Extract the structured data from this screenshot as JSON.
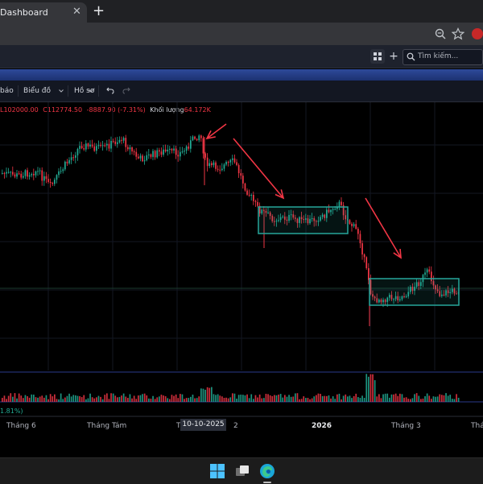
{
  "browser": {
    "tab_title": "Dashboard",
    "tab_close": "✕",
    "new_tab": "+"
  },
  "tv_header": {
    "search_placeholder": "Tìm kiếm..."
  },
  "toolbar": {
    "items": [
      "báo",
      "Biểu đồ",
      "Hồ sơ"
    ],
    "undo_icon": "undo-icon",
    "redo_icon": "redo-icon"
  },
  "legend": {
    "low": "L102000.00",
    "close": "C112774.50",
    "change": "-8887.90 (-7.31%)",
    "volume_label": "Khối lượng",
    "volume_value": "64.172K"
  },
  "volume_pct": "1.81%)",
  "x_axis": {
    "labels": [
      "Tháng 6",
      "Tháng Tám",
      "T",
      "2",
      "2026",
      "Tháng 3",
      "Thá"
    ],
    "highlighted": "10-10-2025"
  },
  "colors": {
    "up": "#22ab94",
    "down": "#f23645",
    "arrow": "#f23645",
    "range_box": "#26a69a"
  },
  "taskbar": {
    "icons": [
      "windows-start-icon",
      "task-view-icon",
      "edge-browser-icon"
    ]
  }
}
